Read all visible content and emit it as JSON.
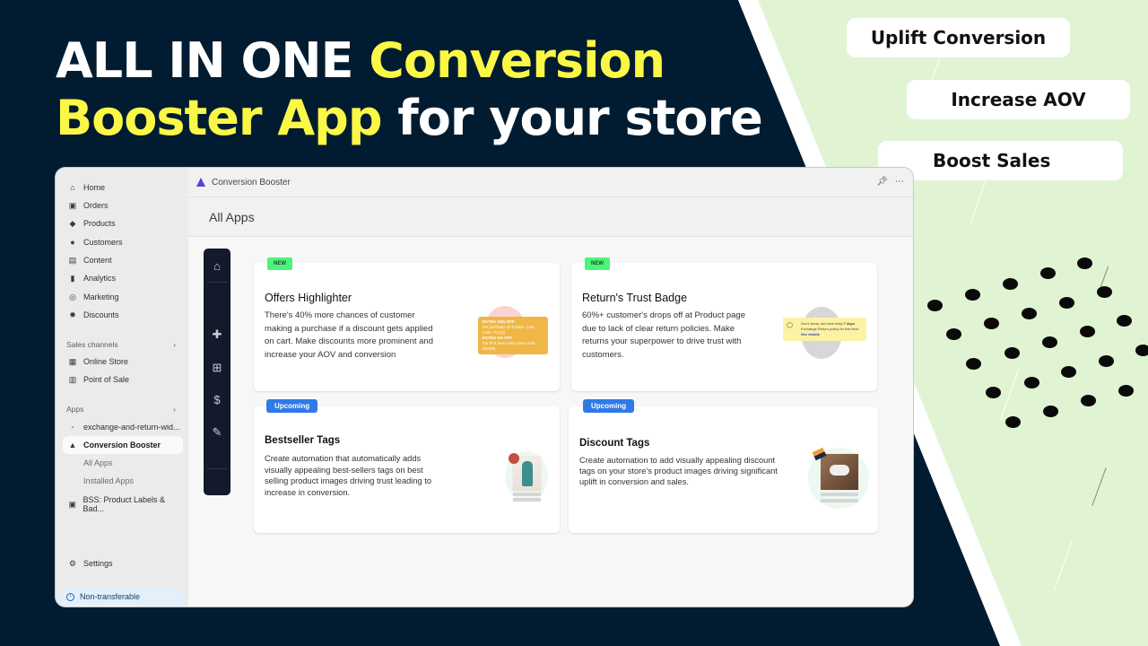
{
  "headline": {
    "line1_white": "ALL IN ONE ",
    "line1_yellow": "Conversion",
    "line2_yellow": "Booster App",
    "line2_white": " for your store"
  },
  "benefits": [
    "Uplift Conversion",
    "Increase AOV",
    "Boost Sales"
  ],
  "colors": {
    "navy": "#011c31",
    "yellow": "#fbf746",
    "mint": "#e0f4d4",
    "new_badge": "#4cf57a",
    "upcoming_badge": "#2f7ae6"
  },
  "app": {
    "title": "Conversion Booster",
    "page_title": "All Apps",
    "top_actions": [
      "pin-icon",
      "more-icon"
    ],
    "sidebar": {
      "items": [
        {
          "label": "Home",
          "icon": "home-icon"
        },
        {
          "label": "Orders",
          "icon": "orders-icon"
        },
        {
          "label": "Products",
          "icon": "tag-icon"
        },
        {
          "label": "Customers",
          "icon": "person-icon"
        },
        {
          "label": "Content",
          "icon": "content-icon"
        },
        {
          "label": "Analytics",
          "icon": "bar-chart-icon"
        },
        {
          "label": "Marketing",
          "icon": "marketing-icon"
        },
        {
          "label": "Discounts",
          "icon": "discount-icon"
        }
      ],
      "sales_channels_label": "Sales channels",
      "sales_channels": [
        {
          "label": "Online Store",
          "icon": "store-icon"
        },
        {
          "label": "Point of Sale",
          "icon": "pos-icon"
        }
      ],
      "apps_label": "Apps",
      "apps": [
        {
          "label": "exchange-and-return-wid...",
          "icon": "app-icon"
        },
        {
          "label": "Conversion Booster",
          "icon": "conversion-booster-logo"
        },
        {
          "label": "All Apps",
          "sub": true
        },
        {
          "label": "Installed Apps",
          "sub": true
        },
        {
          "label": "BSS: Product Labels & Bad...",
          "icon": "bss-icon"
        }
      ],
      "settings_label": "Settings",
      "non_transferable_label": "Non-transferable"
    },
    "rail_icons": [
      "home-icon",
      "pin-icon",
      "add-app-icon",
      "dollar-icon",
      "edit-icon"
    ],
    "cards": [
      {
        "badge": "NEW",
        "title": "Offers Highlighter",
        "description": "There's 40% more chances of customer making a purchase if a discount gets applied on cart. Make discounts more prominent and increase your AOV and conversion",
        "preview": {
          "line1_title": "EXTRA 10% OFF",
          "line1_text": "On purchase of ₹1500+ (use code: PC10)",
          "line2_title": "EXTRA 5% OFF",
          "line2_text": "For first time users (use code: NEW5)"
        }
      },
      {
        "badge": "NEW",
        "title": "Return's Trust Badge",
        "description": "60%+ customer's drops off at Product page due to lack of clear return policies. Make returns your superpower to drive trust with customers.",
        "preview": {
          "text": "Don't worry, we have easy",
          "highlight": "7 days",
          "text2": "Exchange Return policy for this item.",
          "link": "See details"
        }
      },
      {
        "badge": "Upcoming",
        "title": "Bestseller Tags",
        "description": "Create automation that automatically adds visually appealing best-sellers tags on best selling product images driving trust leading to increase in conversion."
      },
      {
        "badge": "Upcoming",
        "title": "Discount Tags",
        "description": "Create automation to add visually appealing discount tags on your store's product images driving significant uplift in conversion and sales."
      }
    ]
  }
}
